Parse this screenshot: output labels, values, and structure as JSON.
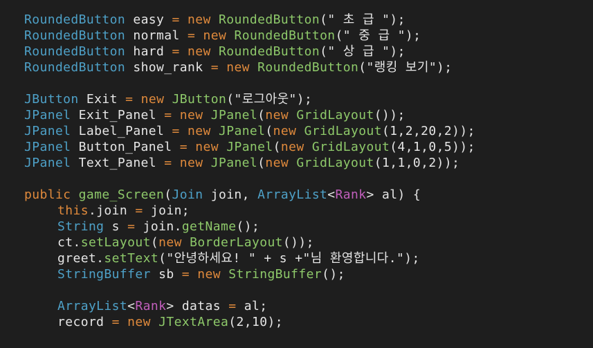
{
  "editor": {
    "lines": [
      {
        "indent": 0,
        "tokens": [
          {
            "t": "RoundedButton",
            "c": "type"
          },
          {
            "t": " easy ",
            "c": "var"
          },
          {
            "t": "=",
            "c": "kw"
          },
          {
            "t": " ",
            "c": "punc"
          },
          {
            "t": "new",
            "c": "kw"
          },
          {
            "t": " ",
            "c": "punc"
          },
          {
            "t": "RoundedButton",
            "c": "class"
          },
          {
            "t": "(\" 초 급 \");",
            "c": "str"
          }
        ]
      },
      {
        "indent": 0,
        "tokens": [
          {
            "t": "RoundedButton",
            "c": "type"
          },
          {
            "t": " normal ",
            "c": "var"
          },
          {
            "t": "=",
            "c": "kw"
          },
          {
            "t": " ",
            "c": "punc"
          },
          {
            "t": "new",
            "c": "kw"
          },
          {
            "t": " ",
            "c": "punc"
          },
          {
            "t": "RoundedButton",
            "c": "class"
          },
          {
            "t": "(\" 중 급 \");",
            "c": "str"
          }
        ]
      },
      {
        "indent": 0,
        "tokens": [
          {
            "t": "RoundedButton",
            "c": "type"
          },
          {
            "t": " hard ",
            "c": "var"
          },
          {
            "t": "=",
            "c": "kw"
          },
          {
            "t": " ",
            "c": "punc"
          },
          {
            "t": "new",
            "c": "kw"
          },
          {
            "t": " ",
            "c": "punc"
          },
          {
            "t": "RoundedButton",
            "c": "class"
          },
          {
            "t": "(\" 상 급 \");",
            "c": "str"
          }
        ]
      },
      {
        "indent": 0,
        "tokens": [
          {
            "t": "RoundedButton",
            "c": "type"
          },
          {
            "t": " show_rank ",
            "c": "var"
          },
          {
            "t": "=",
            "c": "kw"
          },
          {
            "t": " ",
            "c": "punc"
          },
          {
            "t": "new",
            "c": "kw"
          },
          {
            "t": " ",
            "c": "punc"
          },
          {
            "t": "RoundedButton",
            "c": "class"
          },
          {
            "t": "(\"랭킹 보기\");",
            "c": "str"
          }
        ]
      },
      {
        "indent": 0,
        "tokens": []
      },
      {
        "indent": 0,
        "tokens": [
          {
            "t": "JButton",
            "c": "type"
          },
          {
            "t": " Exit ",
            "c": "var"
          },
          {
            "t": "=",
            "c": "kw"
          },
          {
            "t": " ",
            "c": "punc"
          },
          {
            "t": "new",
            "c": "kw"
          },
          {
            "t": " ",
            "c": "punc"
          },
          {
            "t": "JButton",
            "c": "class"
          },
          {
            "t": "(\"로그아웃\");",
            "c": "str"
          }
        ]
      },
      {
        "indent": 0,
        "tokens": [
          {
            "t": "JPanel",
            "c": "type"
          },
          {
            "t": " Exit_Panel ",
            "c": "var"
          },
          {
            "t": "=",
            "c": "kw"
          },
          {
            "t": " ",
            "c": "punc"
          },
          {
            "t": "new",
            "c": "kw"
          },
          {
            "t": " ",
            "c": "punc"
          },
          {
            "t": "JPanel",
            "c": "class"
          },
          {
            "t": "(",
            "c": "punc"
          },
          {
            "t": "new",
            "c": "kw"
          },
          {
            "t": " ",
            "c": "punc"
          },
          {
            "t": "GridLayout",
            "c": "class"
          },
          {
            "t": "());",
            "c": "punc"
          }
        ]
      },
      {
        "indent": 0,
        "tokens": [
          {
            "t": "JPanel",
            "c": "type"
          },
          {
            "t": " Label_Panel ",
            "c": "var"
          },
          {
            "t": "=",
            "c": "kw"
          },
          {
            "t": " ",
            "c": "punc"
          },
          {
            "t": "new",
            "c": "kw"
          },
          {
            "t": " ",
            "c": "punc"
          },
          {
            "t": "JPanel",
            "c": "class"
          },
          {
            "t": "(",
            "c": "punc"
          },
          {
            "t": "new",
            "c": "kw"
          },
          {
            "t": " ",
            "c": "punc"
          },
          {
            "t": "GridLayout",
            "c": "class"
          },
          {
            "t": "(1,2,20,2));",
            "c": "punc"
          }
        ]
      },
      {
        "indent": 0,
        "tokens": [
          {
            "t": "JPanel",
            "c": "type"
          },
          {
            "t": " Button_Panel ",
            "c": "var"
          },
          {
            "t": "=",
            "c": "kw"
          },
          {
            "t": " ",
            "c": "punc"
          },
          {
            "t": "new",
            "c": "kw"
          },
          {
            "t": " ",
            "c": "punc"
          },
          {
            "t": "JPanel",
            "c": "class"
          },
          {
            "t": "(",
            "c": "punc"
          },
          {
            "t": "new",
            "c": "kw"
          },
          {
            "t": " ",
            "c": "punc"
          },
          {
            "t": "GridLayout",
            "c": "class"
          },
          {
            "t": "(4,1,0,5));",
            "c": "punc"
          }
        ]
      },
      {
        "indent": 0,
        "tokens": [
          {
            "t": "JPanel",
            "c": "type"
          },
          {
            "t": " Text_Panel ",
            "c": "var"
          },
          {
            "t": "=",
            "c": "kw"
          },
          {
            "t": " ",
            "c": "punc"
          },
          {
            "t": "new",
            "c": "kw"
          },
          {
            "t": " ",
            "c": "punc"
          },
          {
            "t": "JPanel",
            "c": "class"
          },
          {
            "t": "(",
            "c": "punc"
          },
          {
            "t": "new",
            "c": "kw"
          },
          {
            "t": " ",
            "c": "punc"
          },
          {
            "t": "GridLayout",
            "c": "class"
          },
          {
            "t": "(1,1,0,2));",
            "c": "punc"
          }
        ]
      },
      {
        "indent": 0,
        "tokens": []
      },
      {
        "indent": 0,
        "tokens": [
          {
            "t": "public",
            "c": "kw"
          },
          {
            "t": " ",
            "c": "punc"
          },
          {
            "t": "game_Screen",
            "c": "method"
          },
          {
            "t": "(",
            "c": "punc"
          },
          {
            "t": "Join",
            "c": "type"
          },
          {
            "t": " join, ",
            "c": "var"
          },
          {
            "t": "ArrayList",
            "c": "type"
          },
          {
            "t": "<",
            "c": "punc"
          },
          {
            "t": "Rank",
            "c": "pink"
          },
          {
            "t": "> al) {",
            "c": "punc"
          }
        ]
      },
      {
        "indent": 1,
        "tokens": [
          {
            "t": "this",
            "c": "kw"
          },
          {
            "t": ".join ",
            "c": "var"
          },
          {
            "t": "=",
            "c": "kw"
          },
          {
            "t": " join;",
            "c": "var"
          }
        ]
      },
      {
        "indent": 1,
        "tokens": [
          {
            "t": "String",
            "c": "type"
          },
          {
            "t": " s ",
            "c": "var"
          },
          {
            "t": "=",
            "c": "kw"
          },
          {
            "t": " join.",
            "c": "var"
          },
          {
            "t": "getName",
            "c": "method"
          },
          {
            "t": "();",
            "c": "punc"
          }
        ]
      },
      {
        "indent": 1,
        "tokens": [
          {
            "t": "ct.",
            "c": "var"
          },
          {
            "t": "setLayout",
            "c": "method"
          },
          {
            "t": "(",
            "c": "punc"
          },
          {
            "t": "new",
            "c": "kw"
          },
          {
            "t": " ",
            "c": "punc"
          },
          {
            "t": "BorderLayout",
            "c": "class"
          },
          {
            "t": "());",
            "c": "punc"
          }
        ]
      },
      {
        "indent": 1,
        "tokens": [
          {
            "t": "greet.",
            "c": "var"
          },
          {
            "t": "setText",
            "c": "method"
          },
          {
            "t": "(\"안녕하세요! \" + s +\"님 환영합니다.\");",
            "c": "str"
          }
        ]
      },
      {
        "indent": 1,
        "tokens": [
          {
            "t": "StringBuffer",
            "c": "type"
          },
          {
            "t": " sb ",
            "c": "var"
          },
          {
            "t": "=",
            "c": "kw"
          },
          {
            "t": " ",
            "c": "punc"
          },
          {
            "t": "new",
            "c": "kw"
          },
          {
            "t": " ",
            "c": "punc"
          },
          {
            "t": "StringBuffer",
            "c": "class"
          },
          {
            "t": "();",
            "c": "punc"
          }
        ]
      },
      {
        "indent": 0,
        "tokens": []
      },
      {
        "indent": 1,
        "tokens": [
          {
            "t": "ArrayList",
            "c": "type"
          },
          {
            "t": "<",
            "c": "punc"
          },
          {
            "t": "Rank",
            "c": "pink"
          },
          {
            "t": "> datas ",
            "c": "var"
          },
          {
            "t": "=",
            "c": "kw"
          },
          {
            "t": " al;",
            "c": "var"
          }
        ]
      },
      {
        "indent": 1,
        "tokens": [
          {
            "t": "record ",
            "c": "var"
          },
          {
            "t": "=",
            "c": "kw"
          },
          {
            "t": " ",
            "c": "punc"
          },
          {
            "t": "new",
            "c": "kw"
          },
          {
            "t": " ",
            "c": "punc"
          },
          {
            "t": "JTextArea",
            "c": "class"
          },
          {
            "t": "(2,10);",
            "c": "punc"
          }
        ]
      }
    ]
  }
}
